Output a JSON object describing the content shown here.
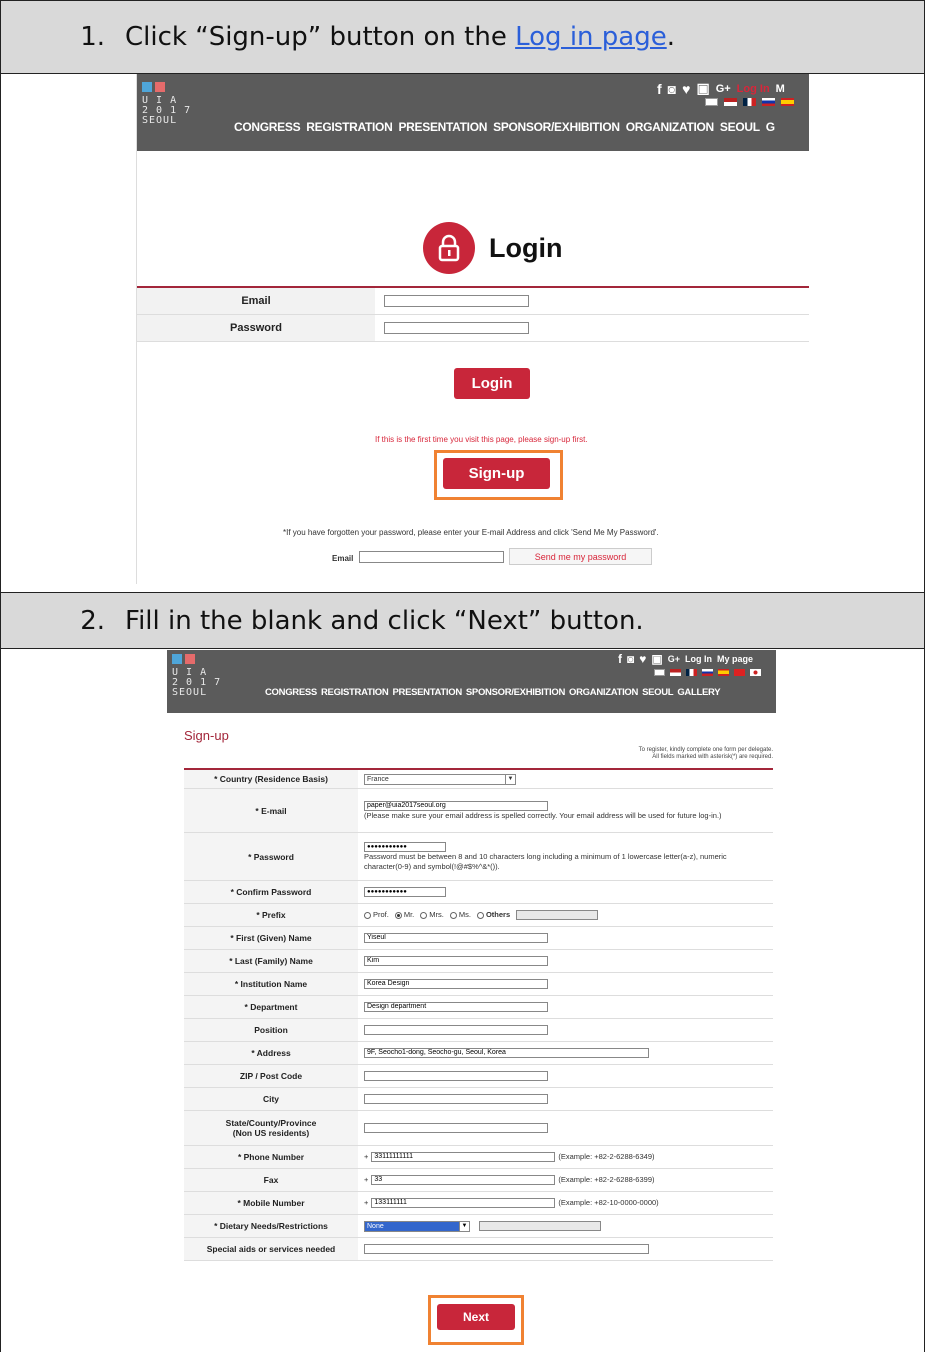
{
  "step1": {
    "number": "1.",
    "text_before": "Click “Sign-up” button on the ",
    "link": "Log in page",
    "text_after": "."
  },
  "step2": {
    "number": "2.",
    "text": "Fill in the blank and click “Next” button."
  },
  "site": {
    "logo_lines": [
      "U I A",
      "2 0 1 7",
      "SEOUL"
    ],
    "nav": [
      "CONGRESS",
      "REGISTRATION",
      "PRESENTATION",
      "SPONSOR/EXHIBITION",
      "ORGANIZATION",
      "SEOUL",
      "GALLERY"
    ],
    "nav_cut_last": "G",
    "social_icons": [
      "f",
      "◙",
      "♥",
      "▣",
      "G+"
    ],
    "login_link": "Log In",
    "mypage_link_cut": "M",
    "mypage_link": "My page"
  },
  "login_page": {
    "title": "Login",
    "email_label": "Email",
    "password_label": "Password",
    "login_button": "Login",
    "first_time_note": "If this is the first time you visit this page, please sign-up first.",
    "signup_button": "Sign-up",
    "forgot_note": "*If you have forgotten your password, please enter your E-mail Address and click 'Send Me My Password'.",
    "forgot_email_label": "Email",
    "send_button": "Send me my password"
  },
  "signup_page": {
    "title": "Sign-up",
    "note_line1": "To register, kindly complete one form per delegate.",
    "note_line2": "All fields marked with asterisk(*) are required.",
    "fields": {
      "country": {
        "label": "* Country (Residence Basis)",
        "value": "France"
      },
      "email": {
        "label": "* E-mail",
        "value": "paper@uia2017seoul.org",
        "help": "(Please make sure your email address is spelled correctly. Your email address will be used for future log-in.)"
      },
      "password": {
        "label": "* Password",
        "value": "●●●●●●●●●●●",
        "help": "Password must be between 8 and 10 characters long including a minimum of 1 lowercase letter(a-z), numeric character(0-9) and symbol(!@#$%^&*())."
      },
      "confirm": {
        "label": "* Confirm Password",
        "value": "●●●●●●●●●●●"
      },
      "prefix": {
        "label": "* Prefix",
        "options": [
          "Prof.",
          "Mr.",
          "Mrs.",
          "Ms.",
          "Others"
        ]
      },
      "first_name": {
        "label": "* First (Given) Name",
        "value": "Yiseul"
      },
      "last_name": {
        "label": "* Last (Family) Name",
        "value": "Kim"
      },
      "institution": {
        "label": "* Institution Name",
        "value": "Korea Design"
      },
      "department": {
        "label": "* Department",
        "value": "Design department"
      },
      "position": {
        "label": "Position",
        "value": ""
      },
      "address": {
        "label": "* Address",
        "value": "9F, Seocho1-dong, Seocho-gu, Seoul, Korea"
      },
      "zip": {
        "label": "ZIP / Post Code",
        "value": ""
      },
      "city": {
        "label": "City",
        "value": ""
      },
      "state": {
        "label": "State/County/Province",
        "label2": "(Non US residents)",
        "value": ""
      },
      "phone": {
        "label": "* Phone Number",
        "prefix": "+",
        "value": "33111111111",
        "example": "(Example: +82-2-6288-6349)"
      },
      "fax": {
        "label": "Fax",
        "prefix": "+",
        "value": "33",
        "example": "(Example: +82-2-6288-6399)"
      },
      "mobile": {
        "label": "* Mobile Number",
        "prefix": "+",
        "value": "133111111",
        "example": "(Example: +82-10-0000-0000)"
      },
      "dietary": {
        "label": "* Dietary Needs/Restrictions",
        "value": "None"
      },
      "special": {
        "label": "Special aids or services needed",
        "value": ""
      }
    },
    "next_button": "Next"
  },
  "colors": {
    "brand_red": "#c8263a",
    "highlight_orange": "#f08232",
    "header_gray": "#5b5b5b",
    "step_bg": "#d9d9d9"
  }
}
